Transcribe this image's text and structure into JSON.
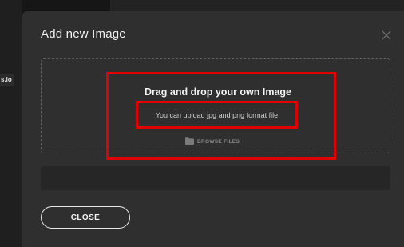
{
  "background": {
    "tag_text": "s.io"
  },
  "modal": {
    "title": "Add new Image",
    "close_icon": "close-x-icon",
    "dropzone": {
      "title": "Drag and drop your own Image",
      "subtitle": "You can upload jpg and png format file",
      "browse_icon": "folder-icon",
      "browse_label": "BROWSE FILES"
    },
    "input_value": "",
    "close_button_label": "CLOSE"
  },
  "colors": {
    "modal_bg": "#2f2f2f",
    "highlight": "#e00000",
    "text": "#f1f1f1"
  }
}
